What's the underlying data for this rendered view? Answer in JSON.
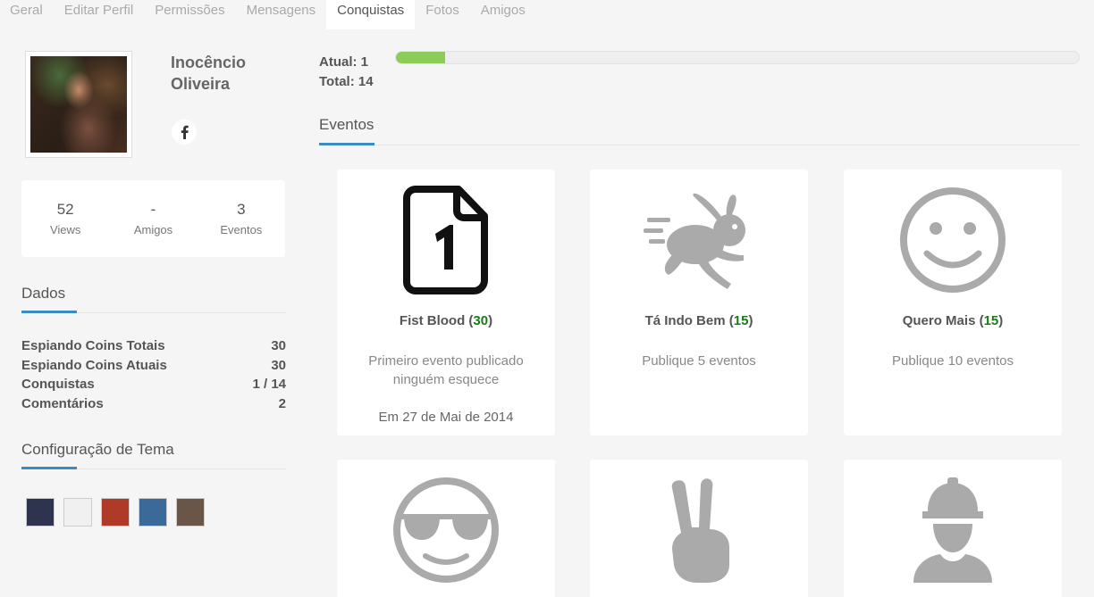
{
  "tabs": [
    "Geral",
    "Editar Perfil",
    "Permissões",
    "Mensagens",
    "Conquistas",
    "Fotos",
    "Amigos"
  ],
  "active_tab": "Conquistas",
  "profile": {
    "name": "Inocêncio Oliveira",
    "social_icon": "facebook-icon"
  },
  "stats": [
    {
      "value": "52",
      "label": "Views"
    },
    {
      "value": "-",
      "label": "Amigos"
    },
    {
      "value": "3",
      "label": "Eventos"
    }
  ],
  "dados": {
    "title": "Dados",
    "rows": [
      {
        "label": "Espiando Coins Totais",
        "value": "30"
      },
      {
        "label": "Espiando Coins Atuais",
        "value": "30"
      },
      {
        "label": "Conquistas",
        "value": "1 / 14"
      },
      {
        "label": "Comentários",
        "value": "2"
      }
    ]
  },
  "tema": {
    "title": "Configuração de Tema",
    "swatches": [
      "#2e3350",
      "#f0f0f0",
      "#b03a28",
      "#3b6a9a",
      "#6a5648"
    ]
  },
  "progress": {
    "atual": "Atual: 1",
    "total": "Total: 14",
    "fraction": 0.0714,
    "color": "#8ccc5a"
  },
  "eventos_title": "Eventos",
  "accent_color": "#3b8ac4",
  "cards": [
    {
      "icon": "document-one-icon",
      "title": "Fist Blood",
      "points": "30",
      "desc": "Primeiro evento publicado ninguém esquece",
      "date": "Em 27 de Mai de 2014",
      "unlocked": true
    },
    {
      "icon": "rabbit-icon",
      "title": "Tá Indo Bem",
      "points": "15",
      "desc": "Publique 5 eventos",
      "date": "",
      "unlocked": false
    },
    {
      "icon": "smiley-icon",
      "title": "Quero Mais",
      "points": "15",
      "desc": "Publique 10 eventos",
      "date": "",
      "unlocked": false
    },
    {
      "icon": "sunglasses-smiley-icon",
      "title": "",
      "points": "",
      "desc": "",
      "date": "",
      "unlocked": false
    },
    {
      "icon": "victory-hand-icon",
      "title": "",
      "points": "",
      "desc": "",
      "date": "",
      "unlocked": false
    },
    {
      "icon": "construction-worker-icon",
      "title": "",
      "points": "",
      "desc": "",
      "date": "",
      "unlocked": false
    }
  ]
}
